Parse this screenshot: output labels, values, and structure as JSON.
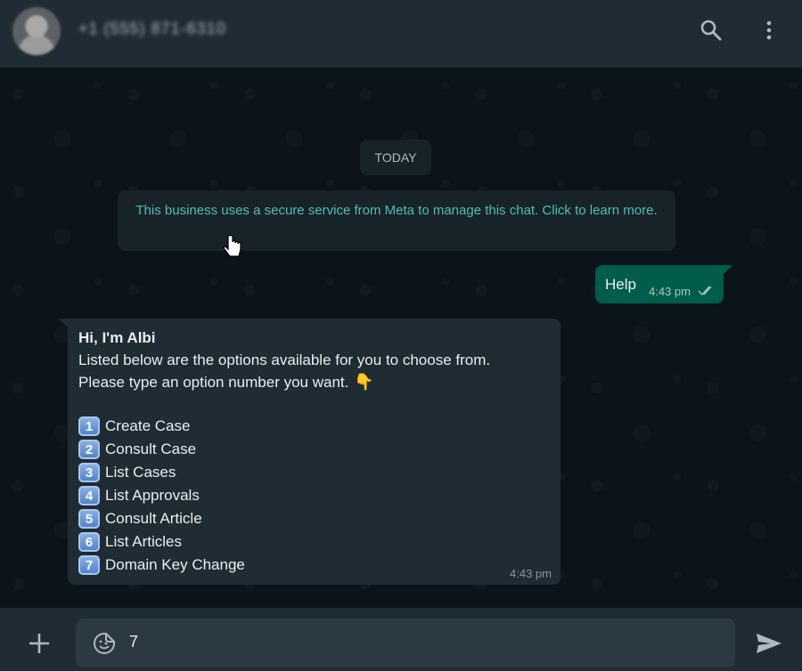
{
  "header": {
    "contact_name": "+1 (555) 871-6310",
    "icons": [
      "search-icon",
      "menu-kebab-icon"
    ]
  },
  "chat": {
    "date_chip": "TODAY",
    "system_message": "This business uses a secure service from Meta to manage this chat. Click to learn more.",
    "outgoing": {
      "text": "Help",
      "time": "4:43 pm",
      "status": "read-double-tick"
    },
    "incoming": {
      "title": "Hi, I'm Albi",
      "line1": "Listed below are the options available for you to choose from.",
      "line2": "Please type an option number you want.",
      "options": [
        {
          "num": "1",
          "label": "Create Case"
        },
        {
          "num": "2",
          "label": "Consult Case"
        },
        {
          "num": "3",
          "label": "List Cases"
        },
        {
          "num": "4",
          "label": "List Approvals"
        },
        {
          "num": "5",
          "label": "Consult Article"
        },
        {
          "num": "6",
          "label": "List Articles"
        },
        {
          "num": "7",
          "label": "Domain Key Change"
        }
      ],
      "time": "4:43 pm"
    }
  },
  "composer": {
    "value": "7",
    "icons": [
      "plus-icon",
      "sticker-icon",
      "send-icon"
    ]
  },
  "colors": {
    "header_bg": "#202c33",
    "chat_bg": "#0b141a",
    "outgoing_bubble": "#005c4b",
    "incoming_bubble": "#202c33",
    "link_teal": "#53bdb1"
  }
}
